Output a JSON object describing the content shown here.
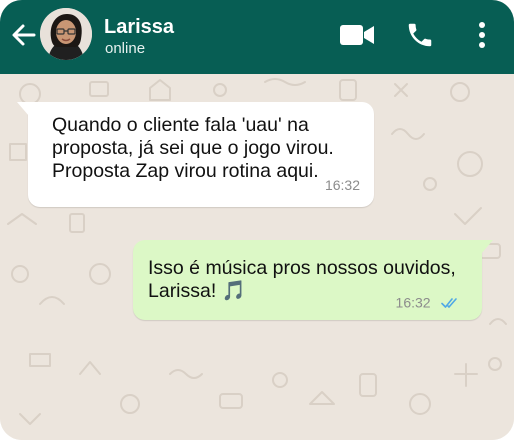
{
  "contact": {
    "name": "Larissa",
    "status": "online"
  },
  "header_icons": [
    "back-arrow-icon",
    "video-call-icon",
    "phone-icon",
    "more-options-icon"
  ],
  "colors": {
    "header": "#075e54",
    "chat_background": "#ece5dd",
    "incoming_bubble": "#ffffff",
    "outgoing_bubble": "#dcf8c6",
    "read_ticks": "#4fa8e6"
  },
  "messages": [
    {
      "direction": "incoming",
      "lines": [
        "Quando o cliente fala 'uau' na",
        "proposta, já sei que o jogo virou.",
        "Proposta Zap virou rotina aqui."
      ],
      "time": "16:32"
    },
    {
      "direction": "outgoing",
      "lines": [
        "Isso é música pros nossos ouvidos,",
        "Larissa! 🎵"
      ],
      "time": "16:32",
      "read_status": "read"
    }
  ]
}
